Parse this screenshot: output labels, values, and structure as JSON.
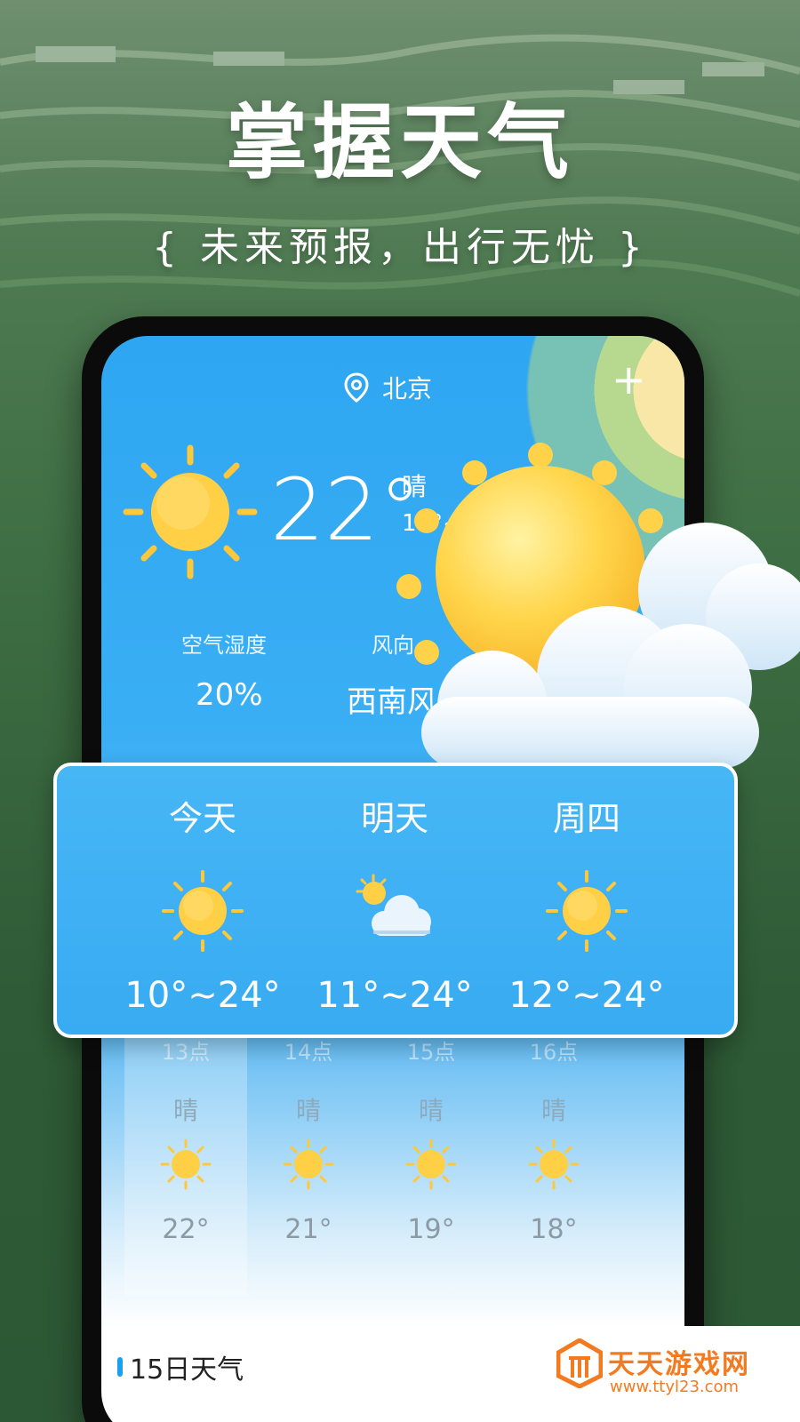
{
  "promo": {
    "title": "掌握天气",
    "subtitle": "{ 未来预报，出行无忧 }"
  },
  "app": {
    "location": "北京",
    "add_icon": "plus-icon",
    "current": {
      "temp": "22°",
      "condition": "晴",
      "range": "10°~",
      "icon": "sun-icon"
    },
    "stats": [
      {
        "label": "空气湿度",
        "value": "20%"
      },
      {
        "label": "风向",
        "value": "西南风"
      }
    ],
    "hourly": [
      {
        "time": "13点",
        "condition": "晴",
        "temp": "22°",
        "icon": "sun-icon"
      },
      {
        "time": "14点",
        "condition": "晴",
        "temp": "21°",
        "icon": "sun-icon"
      },
      {
        "time": "15点",
        "condition": "晴",
        "temp": "19°",
        "icon": "sun-icon"
      },
      {
        "time": "16点",
        "condition": "晴",
        "temp": "18°",
        "icon": "sun-icon"
      }
    ],
    "section_title": "15日天气"
  },
  "forecast_card": {
    "days": [
      {
        "name": "今天",
        "range": "10°~24°",
        "icon": "sun-icon"
      },
      {
        "name": "明天",
        "range": "11°~24°",
        "icon": "partly-cloudy-icon"
      },
      {
        "name": "周四",
        "range": "12°~24°",
        "icon": "sun-icon"
      }
    ]
  },
  "watermark": {
    "name": "天天游戏网",
    "url": "www.ttyl23.com"
  },
  "colors": {
    "accent": "#1aa0ef",
    "sun": "#ffc83a",
    "watermark": "#f47a20"
  }
}
